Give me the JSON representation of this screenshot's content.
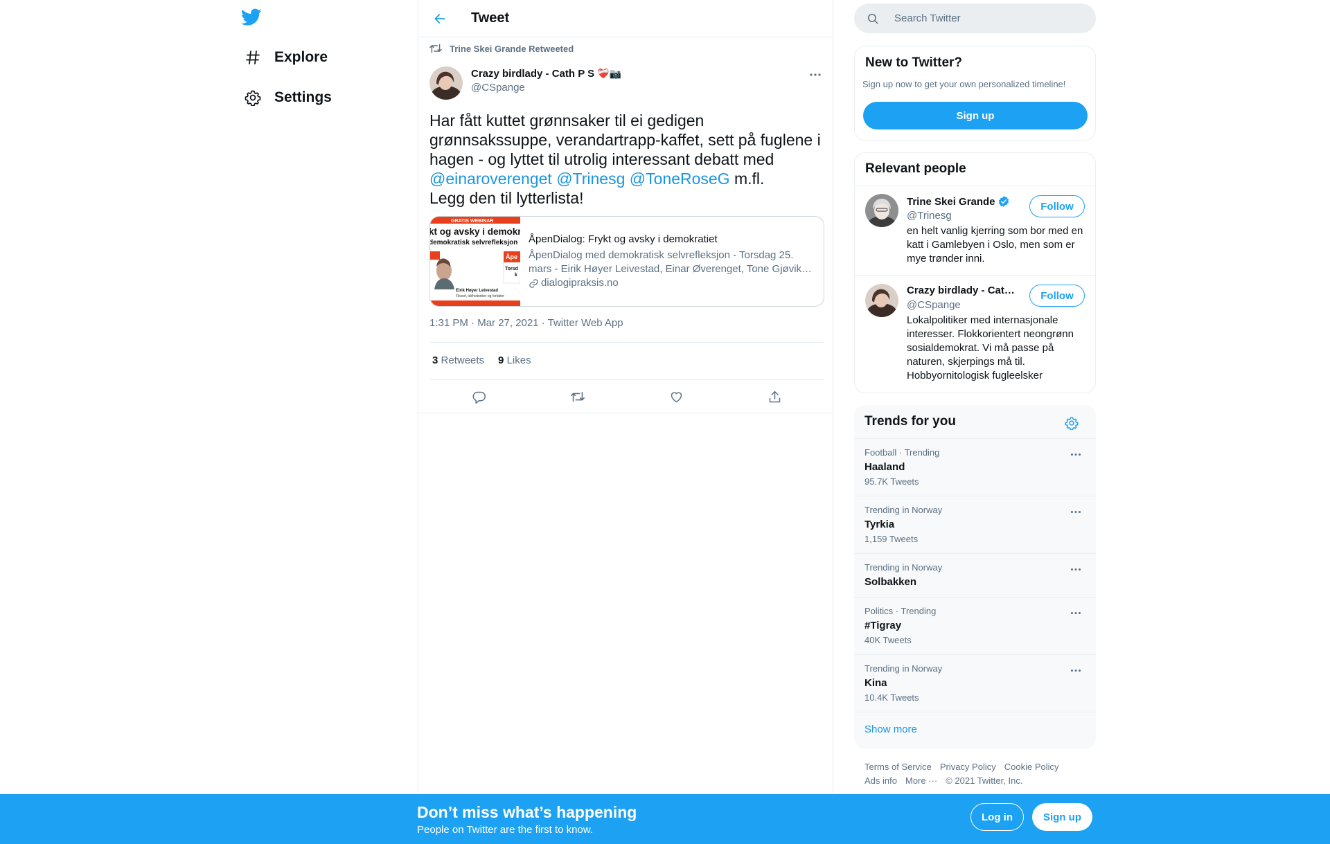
{
  "colors": {
    "brand": "#1da1f2",
    "link": "#1b95e0",
    "secondary_text": "#5b7083",
    "border": "#e6ecf0"
  },
  "nav": {
    "logo_icon": "twitter-bird-icon",
    "items": [
      {
        "label": "Explore",
        "icon": "hashtag-icon"
      },
      {
        "label": "Settings",
        "icon": "gear-icon"
      }
    ]
  },
  "header": {
    "title": "Tweet",
    "back_icon": "arrow-left-icon"
  },
  "tweet": {
    "retweet_context": "Trine Skei Grande Retweeted",
    "author_name": "Crazy birdlady - Cath P S",
    "author_emoji": "❤️‍🩹📷",
    "author_handle": "@CSpange",
    "text_part1": "Har fått kuttet grønnsaker til ei gedigen grønnsakssuppe, verandartrapp-kaffet, sett på fuglene i hagen - og lyttet til utrolig interessant debatt med",
    "mentions": [
      "@einaroverenget",
      "@Trinesg",
      "@ToneRoseG"
    ],
    "text_part2": "m.fl.",
    "text_line2": "Legg den til lytterlista!",
    "card": {
      "image_lines": [
        "GRATIS WEBINAR",
        "kt og avsky i demokr",
        "demokratisk selvrefleksjon",
        "Eirik Høyer Leivestad",
        "Filosof, idéhistoriker og forfatter",
        "Åpe",
        "Torsd",
        "k"
      ],
      "title": "ÅpenDialog: Frykt og avsky i demokratiet",
      "description": "ÅpenDialog med demokratisk selvrefleksjon - Torsdag 25. mars - Eirik Høyer Leivestad, Einar Øverenget, Tone Gjøvik Rose og Trine Skei Grande",
      "domain": "dialogipraksis.no"
    },
    "meta": "1:31 PM · Mar 27, 2021 · Twitter Web App",
    "retweets_count": "3",
    "retweets_label": "Retweets",
    "likes_count": "9",
    "likes_label": "Likes"
  },
  "search": {
    "placeholder": "Search Twitter"
  },
  "new_to_twitter": {
    "title": "New to Twitter?",
    "subtitle": "Sign up now to get your own personalized timeline!",
    "button": "Sign up"
  },
  "relevant_people": {
    "title": "Relevant people",
    "people": [
      {
        "name": "Trine Skei Grande",
        "verified": true,
        "handle": "@Trinesg",
        "bio": "en helt vanlig kjerring som bor med en katt i Gamlebyen i Oslo, men som er mye trønder inni.",
        "button": "Follow"
      },
      {
        "name": "Crazy birdlady - Cat…",
        "verified": false,
        "handle": "@CSpange",
        "bio": "Lokalpolitiker med internasjonale interesser. Flokkorientert neongrønn sosialdemokrat. Vi må passe på naturen, skjerpings må til. Hobbyornitologisk fugleelsker",
        "button": "Follow"
      }
    ]
  },
  "trends": {
    "title": "Trends for you",
    "items": [
      {
        "context": "Football · Trending",
        "name": "Haaland",
        "count": "95.7K Tweets"
      },
      {
        "context": "Trending in Norway",
        "name": "Tyrkia",
        "count": "1,159 Tweets"
      },
      {
        "context": "Trending in Norway",
        "name": "Solbakken",
        "count": ""
      },
      {
        "context": "Politics · Trending",
        "name": "#Tigray",
        "count": "40K Tweets"
      },
      {
        "context": "Trending in Norway",
        "name": "Kina",
        "count": "10.4K Tweets"
      }
    ],
    "show_more": "Show more"
  },
  "footer": {
    "links": [
      "Terms of Service",
      "Privacy Policy",
      "Cookie Policy",
      "Ads info",
      "More ···"
    ],
    "copyright": "© 2021 Twitter, Inc."
  },
  "banner": {
    "title": "Don’t miss what’s happening",
    "subtitle": "People on Twitter are the first to know.",
    "login": "Log in",
    "signup": "Sign up"
  }
}
